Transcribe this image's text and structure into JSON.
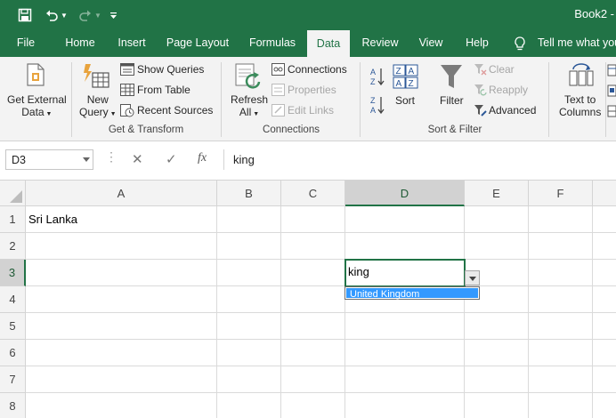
{
  "titlebar": {
    "title": "Book2 -",
    "qa_icons": [
      "save-icon",
      "undo-icon",
      "undo-dropdown-icon",
      "redo-icon",
      "redo-dropdown-icon",
      "customize-qat-icon"
    ]
  },
  "tabs": [
    "File",
    "Home",
    "Insert",
    "Page Layout",
    "Formulas",
    "Data",
    "Review",
    "View",
    "Help"
  ],
  "active_tab": "Data",
  "tell_me": "Tell me what you",
  "ribbon": {
    "get_external_l1": "Get External",
    "get_external_l2": "Data",
    "new_query_l1": "New",
    "new_query_l2": "Query",
    "show_queries": "Show Queries",
    "from_table": "From Table",
    "recent_sources": "Recent Sources",
    "group_get_transform": "Get & Transform",
    "refresh_l1": "Refresh",
    "refresh_l2": "All",
    "connections": "Connections",
    "properties": "Properties",
    "edit_links": "Edit Links",
    "group_connections": "Connections",
    "sort": "Sort",
    "filter": "Filter",
    "clear": "Clear",
    "reapply": "Reapply",
    "advanced": "Advanced",
    "group_sort_filter": "Sort & Filter",
    "text_to_columns_l1": "Text to",
    "text_to_columns_l2": "Columns"
  },
  "formula_bar": {
    "name_box": "D3",
    "cancel": "✕",
    "enter": "✓",
    "fx": "fx",
    "content": "king"
  },
  "columns": [
    "A",
    "B",
    "C",
    "D",
    "E",
    "F"
  ],
  "rows": [
    "1",
    "2",
    "3",
    "4",
    "5",
    "6",
    "7",
    "8"
  ],
  "cells": {
    "A1": "Sri  Lanka"
  },
  "active_cell": {
    "ref": "D3",
    "value": "king"
  },
  "autocomplete": [
    "United Kingdom"
  ],
  "colors": {
    "accent": "#217346",
    "selection": "#3399ff"
  }
}
